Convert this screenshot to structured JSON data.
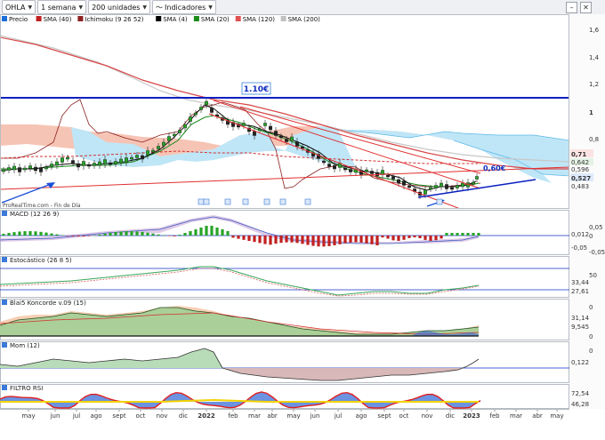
{
  "toolbar": {
    "symbol": "OHLA",
    "period": "1 semana",
    "units": "200 unidades",
    "indicators": "Indicadores",
    "minimize": "–",
    "close": "✕"
  },
  "main_legend": [
    {
      "label": "Precio",
      "color": "#1a6ed8"
    },
    {
      "label": "SMA (40)",
      "color": "#c02020"
    },
    {
      "label": "Ichimoku (9 26 52)",
      "color": "#8b2020"
    },
    {
      "label": "SMA (4)",
      "color": "#000000"
    },
    {
      "label": "SMA (20)",
      "color": "#1a8a1a"
    },
    {
      "label": "SMA (120)",
      "color": "#e05050"
    },
    {
      "label": "SMA (200)",
      "color": "#c0c0c0"
    }
  ],
  "price_axis": [
    "1,6",
    "1,4",
    "1,2",
    "1",
    "0,8",
    "0,483"
  ],
  "price_tags": [
    {
      "text": "0,642",
      "color": "#1a8a1a"
    },
    {
      "text": "0,71",
      "color": "#c02020"
    },
    {
      "text": "0,527",
      "color": "#1a6ed8"
    },
    {
      "text": "0,596",
      "color": "#e05050"
    }
  ],
  "annotations": {
    "resistance": "1.10€",
    "support": "0,60€"
  },
  "watermark": "ProRealTime.com - Fin de Día",
  "macd": {
    "label": "MACD (12 26 9)",
    "axis": [
      "0,05",
      "0",
      "-0,05",
      "0,012",
      "-0,05"
    ]
  },
  "stoch": {
    "label": "Estocástico (26 8 5)",
    "axis": [
      "50",
      "33,44",
      "27,61"
    ]
  },
  "blai": {
    "label": "Blai5 Koncorde v.09 (15)",
    "axis": [
      "0",
      "31,14",
      "9,545",
      "0"
    ]
  },
  "mom": {
    "label": "Mom (12)",
    "axis": [
      "0",
      "0,122"
    ]
  },
  "rsi": {
    "label": "FILTRO RSI",
    "axis": [
      "72,54",
      "46,28"
    ]
  },
  "x_axis": [
    "may",
    "jun",
    "jul",
    "ago",
    "sept",
    "oct",
    "nov",
    "dic",
    "2022",
    "feb",
    "mar",
    "abr",
    "may",
    "jun",
    "jul",
    "ago",
    "sept",
    "oct",
    "nov",
    "dic",
    "2023",
    "feb",
    "mar",
    "abr",
    "may"
  ],
  "colors": {
    "blue": "#1a6ed8",
    "red": "#d42020",
    "green": "#1a8a1a",
    "navy": "#1030c0",
    "cloud_red": "#f4b8a8",
    "cloud_blue": "#b8e2f4"
  }
}
